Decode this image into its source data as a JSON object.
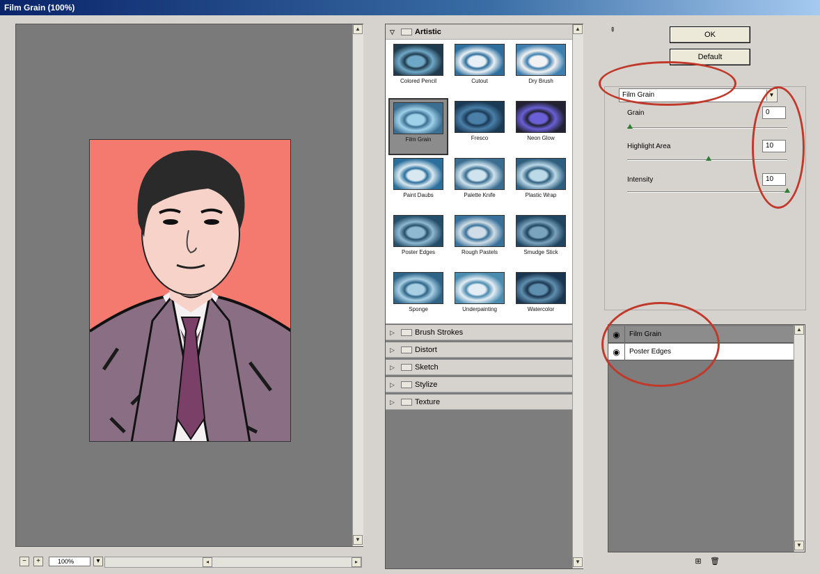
{
  "window": {
    "title": "Film Grain (100%)"
  },
  "preview": {
    "zoom_value": "100%",
    "zoom_minus": "−",
    "zoom_plus": "+"
  },
  "filter_gallery": {
    "categories": [
      {
        "name": "Artistic",
        "expanded": true,
        "filters": [
          {
            "label": "Colored Pencil"
          },
          {
            "label": "Cutout"
          },
          {
            "label": "Dry Brush"
          },
          {
            "label": "Film Grain",
            "selected": true
          },
          {
            "label": "Fresco"
          },
          {
            "label": "Neon Glow"
          },
          {
            "label": "Paint Daubs"
          },
          {
            "label": "Palette Knife"
          },
          {
            "label": "Plastic Wrap"
          },
          {
            "label": "Poster Edges"
          },
          {
            "label": "Rough Pastels"
          },
          {
            "label": "Smudge Stick"
          },
          {
            "label": "Sponge"
          },
          {
            "label": "Underpainting"
          },
          {
            "label": "Watercolor"
          }
        ]
      },
      {
        "name": "Brush Strokes",
        "expanded": false
      },
      {
        "name": "Distort",
        "expanded": false
      },
      {
        "name": "Sketch",
        "expanded": false
      },
      {
        "name": "Stylize",
        "expanded": false
      },
      {
        "name": "Texture",
        "expanded": false
      }
    ]
  },
  "controls": {
    "ok_label": "OK",
    "default_label": "Default",
    "selected_filter": "Film Grain",
    "params": [
      {
        "label": "Grain",
        "value": "0",
        "slider_fraction": 0.0
      },
      {
        "label": "Highlight Area",
        "value": "10",
        "slider_fraction": 0.5
      },
      {
        "label": "Intensity",
        "value": "10",
        "slider_fraction": 1.0
      }
    ]
  },
  "layers": [
    {
      "name": "Film Grain",
      "selected": true
    },
    {
      "name": "Poster Edges",
      "selected": false
    }
  ],
  "colors": {
    "annotation": "#c0392b",
    "photo_background": "#f47a70",
    "pane_gray": "#7d7d7d",
    "slider_thumb": "#2e7d32"
  }
}
